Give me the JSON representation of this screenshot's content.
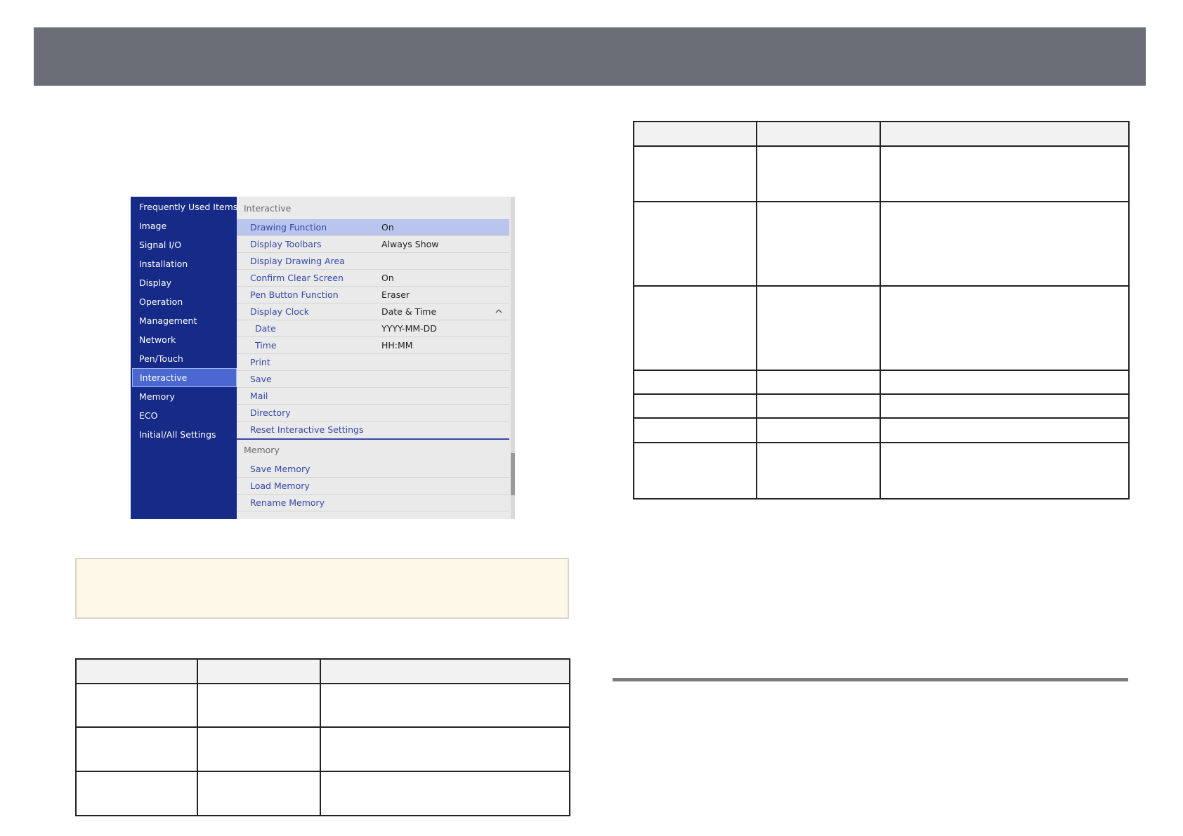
{
  "menu": {
    "sidebar": [
      {
        "label": "Frequently Used Items",
        "active": false
      },
      {
        "label": "Image",
        "active": false
      },
      {
        "label": "Signal I/O",
        "active": false
      },
      {
        "label": "Installation",
        "active": false
      },
      {
        "label": "Display",
        "active": false
      },
      {
        "label": "Operation",
        "active": false
      },
      {
        "label": "Management",
        "active": false
      },
      {
        "label": "Network",
        "active": false
      },
      {
        "label": "Pen/Touch",
        "active": false
      },
      {
        "label": "Interactive",
        "active": true
      },
      {
        "label": "Memory",
        "active": false
      },
      {
        "label": "ECO",
        "active": false
      },
      {
        "label": "Initial/All Settings",
        "active": false
      }
    ],
    "interactive_section": {
      "heading": "Interactive",
      "rows": [
        {
          "label": "Drawing Function",
          "value": "On",
          "selected": true
        },
        {
          "label": "Display Toolbars",
          "value": "Always Show"
        },
        {
          "label": "Display Drawing Area",
          "value": ""
        },
        {
          "label": "Confirm Clear Screen",
          "value": "On"
        },
        {
          "label": "Pen Button Function",
          "value": "Eraser"
        },
        {
          "label": "Display Clock",
          "value": "Date & Time",
          "expanded_icon": "chevron-up-icon"
        },
        {
          "label": "Date",
          "value": "YYYY-MM-DD",
          "sub": true
        },
        {
          "label": "Time",
          "value": "HH:MM",
          "sub": true
        },
        {
          "label": "Print",
          "value": ""
        },
        {
          "label": "Save",
          "value": ""
        },
        {
          "label": "Mail",
          "value": ""
        },
        {
          "label": "Directory",
          "value": ""
        },
        {
          "label": "Reset Interactive Settings",
          "value": ""
        }
      ]
    },
    "memory_section": {
      "heading": "Memory",
      "rows": [
        {
          "label": "Save Memory"
        },
        {
          "label": "Load Memory"
        },
        {
          "label": "Rename Memory"
        }
      ]
    },
    "colors": {
      "sidebar_bg": "#162a87",
      "sidebar_active": "#4a68cf",
      "row_selected": "#b9c5ec",
      "item_text": "#3548a8"
    }
  }
}
